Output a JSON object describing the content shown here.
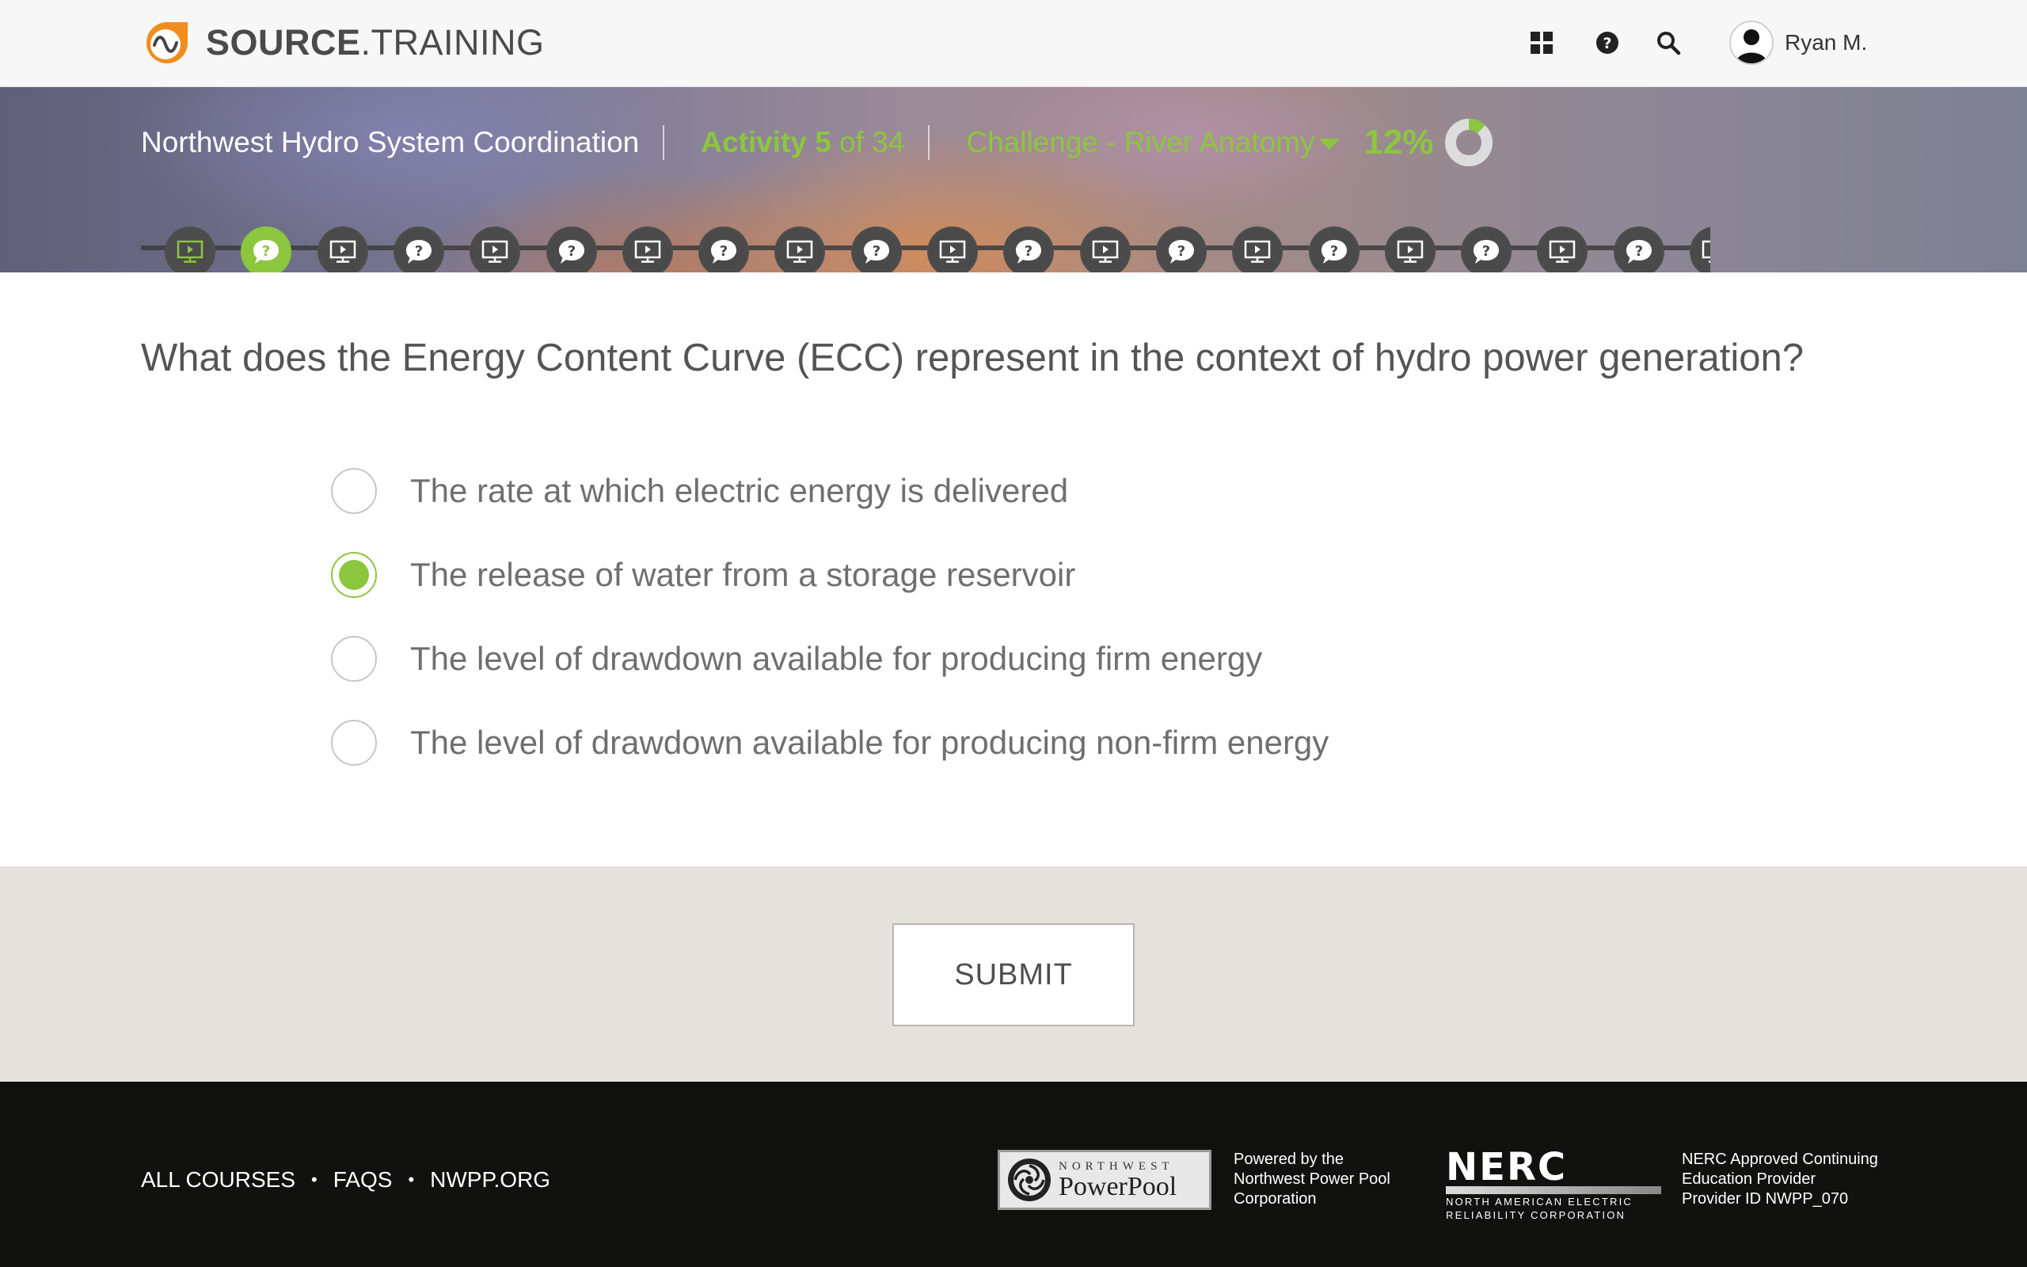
{
  "brand": {
    "name_bold": "SOURCE",
    "name_light": ".TRAINING",
    "accent_color": "#8cc63f",
    "logo_color": "#f28c1e"
  },
  "header": {
    "icons": [
      "grid-icon",
      "help-icon",
      "search-icon"
    ],
    "user_name": "Ryan M."
  },
  "course": {
    "title": "Northwest Hydro System Coordination",
    "activity_prefix": "Activity",
    "activity_number": "5",
    "activity_suffix": " of 34",
    "challenge_label": "Challenge - River Anatomy",
    "progress_percent": "12%",
    "progress_fraction": 0.12,
    "steps": [
      {
        "type": "video",
        "state": "done"
      },
      {
        "type": "question",
        "state": "current"
      },
      {
        "type": "video",
        "state": "pending"
      },
      {
        "type": "question",
        "state": "pending"
      },
      {
        "type": "video",
        "state": "pending"
      },
      {
        "type": "question",
        "state": "pending"
      },
      {
        "type": "video",
        "state": "pending"
      },
      {
        "type": "question",
        "state": "pending"
      },
      {
        "type": "video",
        "state": "pending"
      },
      {
        "type": "question",
        "state": "pending"
      },
      {
        "type": "video",
        "state": "pending"
      },
      {
        "type": "question",
        "state": "pending"
      },
      {
        "type": "video",
        "state": "pending"
      },
      {
        "type": "question",
        "state": "pending"
      },
      {
        "type": "video",
        "state": "pending"
      },
      {
        "type": "question",
        "state": "pending"
      },
      {
        "type": "video",
        "state": "pending"
      },
      {
        "type": "question",
        "state": "pending"
      },
      {
        "type": "video",
        "state": "pending"
      },
      {
        "type": "question",
        "state": "pending"
      },
      {
        "type": "video",
        "state": "pending"
      }
    ]
  },
  "quiz": {
    "question": "What does the Energy Content Curve (ECC) represent in the context of hydro power generation?",
    "options": [
      {
        "label": "The rate at which electric energy is delivered",
        "selected": false
      },
      {
        "label": "The release of water from a storage reservoir",
        "selected": true
      },
      {
        "label": "The level of drawdown available for producing firm energy",
        "selected": false
      },
      {
        "label": "The level of drawdown available for producing non-firm energy",
        "selected": false
      }
    ],
    "submit_label": "SUBMIT"
  },
  "footer": {
    "links": [
      "ALL COURSES",
      "FAQS",
      "NWPP.ORG"
    ],
    "npp_logo_small": "NORTHWEST",
    "npp_logo_big": "PowerPool",
    "npp_text_1": "Powered by the",
    "npp_text_2": "Northwest Power Pool",
    "npp_text_3": "Corporation",
    "nerc_logo_big": "NERC",
    "nerc_logo_sub_1": "NORTH AMERICAN ELECTRIC",
    "nerc_logo_sub_2": "RELIABILITY CORPORATION",
    "nerc_text_1": "NERC Approved Continuing",
    "nerc_text_2": "Education Provider",
    "nerc_text_3": "Provider ID NWPP_070"
  }
}
